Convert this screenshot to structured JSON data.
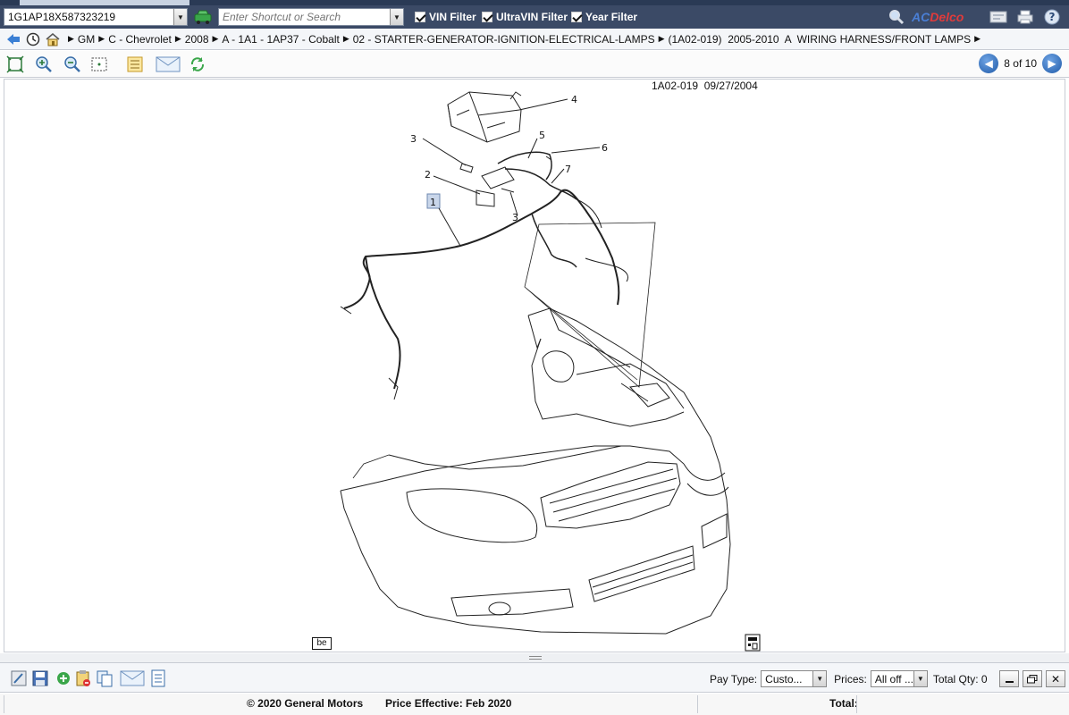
{
  "search": {
    "vin_value": "1G1AP18X587323219",
    "shortcut_placeholder": "Enter Shortcut or Search",
    "filters": [
      {
        "label": "VIN Filter",
        "checked": true
      },
      {
        "label": "UltraVIN Filter",
        "checked": true
      },
      {
        "label": "Year Filter",
        "checked": true
      }
    ],
    "brand": {
      "ac": "AC",
      "delco": "Delco"
    }
  },
  "breadcrumb": {
    "items": [
      "GM",
      "C - Chevrolet",
      "2008",
      "A - 1A1 - 1AP37 - Cobalt",
      "02 - STARTER-GENERATOR-IGNITION-ELECTRICAL-LAMPS",
      "(1A02-019)  2005-2010  A  WIRING HARNESS/FRONT LAMPS"
    ]
  },
  "pager": {
    "text": "8 of 10"
  },
  "diagram": {
    "caption": "1A02-019  09/27/2004",
    "callouts": [
      "1",
      "2",
      "3",
      "3",
      "4",
      "5",
      "6",
      "7"
    ],
    "badge": "be"
  },
  "bottom": {
    "pay_type_label": "Pay Type:",
    "pay_type_value": "Custo...",
    "prices_label": "Prices:",
    "prices_value": "All off ...",
    "total_qty": "Total Qty: 0"
  },
  "footer": {
    "copyright": "© 2020 General Motors",
    "price_effective": "Price Effective: Feb 2020",
    "total_label": "Total:"
  },
  "colors": {
    "topbar": "#3b4a66",
    "accent": "#1f5aa8",
    "ac_blue": "#4a7fd6",
    "delco_red": "#e03b3b"
  },
  "icons": [
    "car-icon",
    "magnifier-icon",
    "acdelco-logo",
    "catalog-icon",
    "printer-icon",
    "help-icon",
    "back-icon",
    "history-icon",
    "home-icon",
    "fit-icon",
    "zoom-in-icon",
    "zoom-out-icon",
    "select-icon",
    "list-icon",
    "email-icon",
    "refresh-icon",
    "prev-arrow-icon",
    "next-arrow-icon"
  ]
}
